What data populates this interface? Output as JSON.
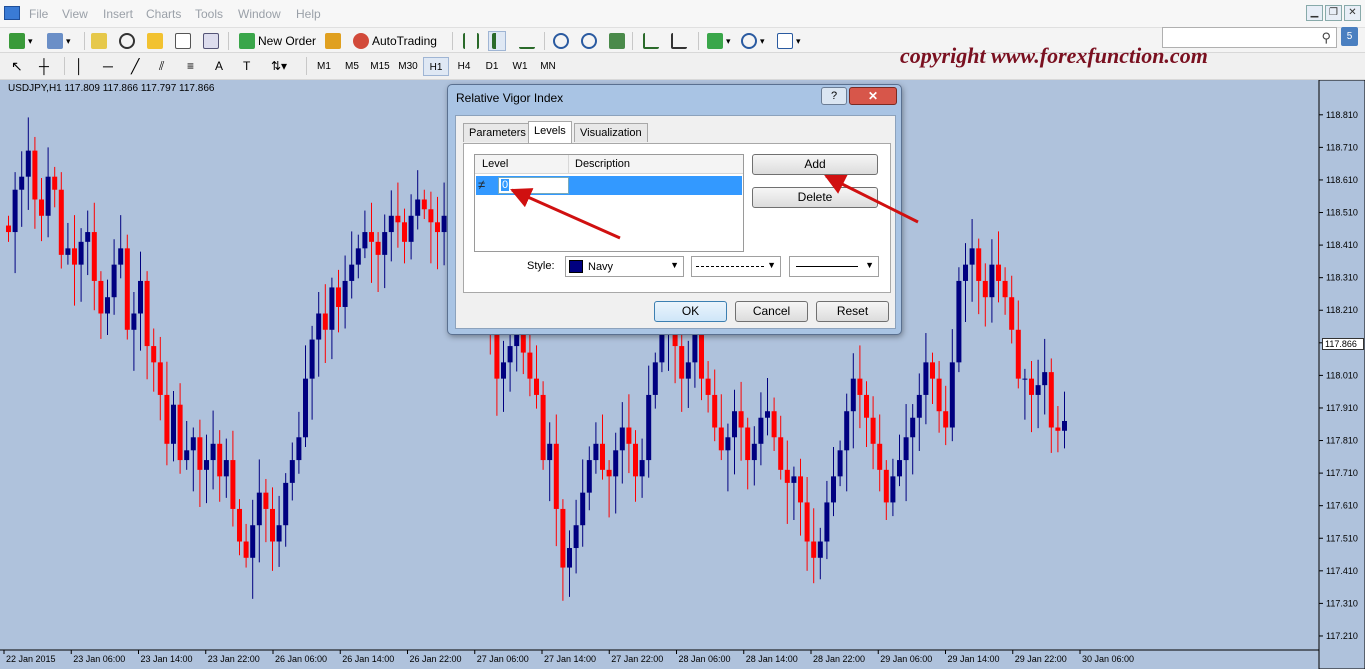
{
  "menu": [
    "File",
    "View",
    "Insert",
    "Charts",
    "Tools",
    "Window",
    "Help"
  ],
  "toolbar": {
    "new_order": "New Order",
    "autotrading": "AutoTrading",
    "timeframes": [
      "M1",
      "M5",
      "M15",
      "M30",
      "H1",
      "H4",
      "D1",
      "W1",
      "MN"
    ],
    "active_timeframe": "H1"
  },
  "badge": "5",
  "copyright": "copyright www.forexfunction.com",
  "chart": {
    "label": "USDJPY,H1  117.809 117.866 117.797 117.866",
    "current_price": "117.866",
    "up_color": "#000080",
    "down_color": "#ff0000",
    "bg_color": "#afc2dc"
  },
  "chart_data": {
    "type": "candlestick",
    "symbol": "USDJPY",
    "timeframe": "H1",
    "ohlc_last": {
      "open": 117.809,
      "high": 117.866,
      "low": 117.797,
      "close": 117.866
    },
    "y_ticks": [
      "118.810",
      "118.710",
      "118.610",
      "118.510",
      "118.410",
      "118.310",
      "118.210",
      "118.110",
      "118.010",
      "117.910",
      "117.810",
      "117.710",
      "117.610",
      "117.510",
      "117.410",
      "117.310",
      "117.210"
    ],
    "x_ticks": [
      "22 Jan 2015",
      "23 Jan 06:00",
      "23 Jan 14:00",
      "23 Jan 22:00",
      "26 Jan 06:00",
      "26 Jan 14:00",
      "26 Jan 22:00",
      "27 Jan 06:00",
      "27 Jan 14:00",
      "27 Jan 22:00",
      "28 Jan 06:00",
      "28 Jan 14:00",
      "28 Jan 22:00",
      "29 Jan 06:00",
      "29 Jan 14:00",
      "29 Jan 22:00",
      "30 Jan 06:00"
    ],
    "ylim": [
      117.17,
      118.88
    ],
    "closes": [
      118.45,
      118.58,
      118.62,
      118.7,
      118.55,
      118.5,
      118.62,
      118.58,
      118.38,
      118.4,
      118.35,
      118.42,
      118.45,
      118.3,
      118.2,
      118.25,
      118.35,
      118.4,
      118.15,
      118.2,
      118.3,
      118.1,
      118.05,
      117.95,
      117.8,
      117.92,
      117.75,
      117.78,
      117.82,
      117.72,
      117.75,
      117.8,
      117.7,
      117.75,
      117.6,
      117.5,
      117.45,
      117.55,
      117.65,
      117.6,
      117.5,
      117.55,
      117.68,
      117.75,
      117.82,
      118.0,
      118.12,
      118.2,
      118.15,
      118.28,
      118.22,
      118.3,
      118.35,
      118.4,
      118.45,
      118.42,
      118.38,
      118.45,
      118.5,
      118.48,
      118.42,
      118.5,
      118.55,
      118.52,
      118.48,
      118.45,
      118.5,
      118.55,
      118.6,
      118.52,
      118.4,
      118.35,
      118.3,
      118.2,
      118.0,
      118.05,
      118.1,
      118.15,
      118.08,
      118.0,
      117.95,
      117.75,
      117.8,
      117.6,
      117.42,
      117.48,
      117.55,
      117.65,
      117.75,
      117.8,
      117.72,
      117.7,
      117.78,
      117.85,
      117.8,
      117.7,
      117.75,
      117.95,
      118.05,
      118.15,
      118.2,
      118.1,
      118.0,
      118.05,
      118.15,
      118.0,
      117.95,
      117.85,
      117.78,
      117.82,
      117.9,
      117.85,
      117.75,
      117.8,
      117.88,
      117.9,
      117.82,
      117.72,
      117.68,
      117.7,
      117.62,
      117.5,
      117.45,
      117.5,
      117.62,
      117.7,
      117.78,
      117.9,
      118.0,
      117.95,
      117.88,
      117.8,
      117.72,
      117.62,
      117.7,
      117.75,
      117.82,
      117.88,
      117.95,
      118.05,
      118.0,
      117.9,
      117.85,
      118.05,
      118.3,
      118.35,
      118.4,
      118.3,
      118.25,
      118.35,
      118.3,
      118.25,
      118.15,
      118.0,
      118.0,
      117.95,
      117.98,
      118.02,
      117.85,
      117.84,
      117.87
    ]
  },
  "dialog": {
    "title": "Relative Vigor Index",
    "help": "?",
    "close": "✕",
    "tabs": [
      "Parameters",
      "Levels",
      "Visualization"
    ],
    "active_tab": "Levels",
    "levels_table": {
      "columns": [
        "Level",
        "Description"
      ],
      "rows": [
        {
          "level": "0",
          "description": ""
        }
      ]
    },
    "add_label": "Add",
    "delete_label": "Delete",
    "style_label": "Style:",
    "color_value": "Navy",
    "color_hex": "#000080",
    "line_style": "dashed",
    "line_width": "solid-thin",
    "ok_label": "OK",
    "cancel_label": "Cancel",
    "reset_label": "Reset"
  }
}
